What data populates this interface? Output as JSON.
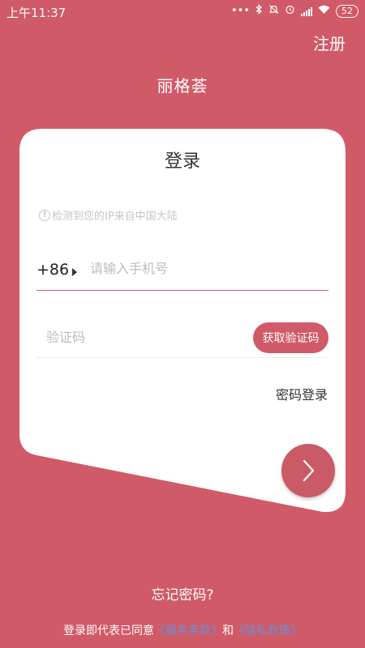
{
  "status_bar": {
    "time": "上午11:37",
    "dots": "•••",
    "battery": "52",
    "icons": [
      "bluetooth-icon",
      "mute-icon",
      "alarm-icon",
      "signal-icon",
      "wifi-icon",
      "battery-icon"
    ]
  },
  "header": {
    "register_label": "注册",
    "brand": "丽格荟"
  },
  "card": {
    "title": "登录",
    "ip_notice": "检测到您的IP来自中国大陆",
    "country_code": "+86",
    "phone_placeholder": "请输入手机号",
    "code_placeholder": "验证码",
    "get_code_label": "获取验证码",
    "password_login_label": "密码登录"
  },
  "footer": {
    "forgot_password": "忘记密码?",
    "agreement_prefix": "登录即代表已同意",
    "terms_link": "《服务条款》",
    "and": "和",
    "privacy_link": "《隐私政策》"
  },
  "colors": {
    "accent": "#d05a68",
    "card": "#ffffff",
    "link": "#6c8fd6"
  }
}
